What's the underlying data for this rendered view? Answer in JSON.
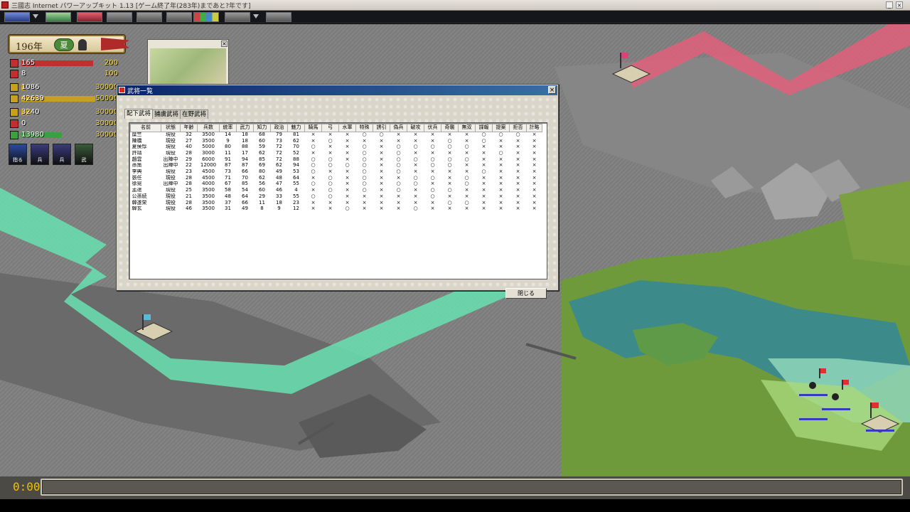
{
  "window": {
    "title": "三國志 Internet パワーアップキット 1.13 [ゲーム終了年(283年)まであと?年です]",
    "minimize": "_",
    "close": "×"
  },
  "status": {
    "year": "196年",
    "season": "夏",
    "stats": [
      {
        "icon": "soldier-icon",
        "value": "165",
        "max": "200",
        "color": "#c03030",
        "fill": 0.83
      },
      {
        "icon": "training-icon",
        "value": "8",
        "max": "100",
        "color": "#c03030",
        "fill": 0
      },
      {
        "icon": "gold-icon",
        "value": "1086",
        "max": "30000",
        "color": "#c8a020",
        "fill": 0.04
      },
      {
        "icon": "food-icon",
        "value": "42639",
        "max": "50000",
        "color": "#c8a020",
        "fill": 0.85
      },
      {
        "icon": "population-icon",
        "value": "3240",
        "max": "30000",
        "color": "#c8a020",
        "fill": 0.11
      },
      {
        "icon": "order-icon",
        "value": "0",
        "max": "30000",
        "color": "#c03030",
        "fill": 0
      },
      {
        "icon": "troops-icon",
        "value": "13980",
        "max": "30000",
        "color": "#3aa040",
        "fill": 0.47
      }
    ],
    "commands": [
      {
        "name": "hand-command-button",
        "label": "指る",
        "color": "#2a4aa0"
      },
      {
        "name": "officer-command-button-1",
        "label": "兵",
        "color": "#3a3a80"
      },
      {
        "name": "officer-command-button-2",
        "label": "兵",
        "color": "#3a3a80"
      },
      {
        "name": "officer-command-button-3",
        "label": "武",
        "color": "#3a5a3a"
      }
    ]
  },
  "minimap": {
    "close": "×"
  },
  "dialog": {
    "title": "武将一覧",
    "close_icon": "×",
    "tabs": [
      "配下武将",
      "捕虜武将",
      "在野武将"
    ],
    "columns": [
      "名前",
      "状態",
      "年齢",
      "兵数",
      "統率",
      "武力",
      "知力",
      "政治",
      "魅力",
      "騎馬",
      "弓",
      "水軍",
      "特殊",
      "誘引",
      "偽兵",
      "破攻",
      "伏兵",
      "奇襲",
      "無双",
      "諜報",
      "提案",
      "拒否",
      "計略"
    ],
    "rows": [
      [
        "糜竺",
        "現役",
        "32",
        "3500",
        "14",
        "18",
        "68",
        "79",
        "81",
        "×",
        "×",
        "×",
        "○",
        "○",
        "×",
        "×",
        "×",
        "×",
        "×",
        "○",
        "○",
        "○",
        "×"
      ],
      [
        "陳橋",
        "現役",
        "27",
        "3500",
        "9",
        "18",
        "60",
        "73",
        "62",
        "×",
        "○",
        "×",
        "×",
        "×",
        "×",
        "×",
        "×",
        "○",
        "×",
        "○",
        "×",
        "×",
        "×"
      ],
      [
        "夏侯惇",
        "現役",
        "40",
        "5000",
        "80",
        "88",
        "59",
        "72",
        "70",
        "○",
        "×",
        "×",
        "○",
        "×",
        "○",
        "○",
        "○",
        "○",
        "○",
        "×",
        "×",
        "×",
        "×"
      ],
      [
        "許靖",
        "現役",
        "28",
        "3000",
        "11",
        "17",
        "62",
        "72",
        "52",
        "×",
        "×",
        "×",
        "○",
        "×",
        "○",
        "×",
        "×",
        "×",
        "×",
        "×",
        "○",
        "×",
        "×"
      ],
      [
        "趙雲",
        "出陣中",
        "29",
        "6000",
        "91",
        "94",
        "85",
        "72",
        "88",
        "○",
        "○",
        "×",
        "○",
        "×",
        "○",
        "○",
        "○",
        "○",
        "○",
        "×",
        "×",
        "×",
        "×"
      ],
      [
        "孫策",
        "出陣中",
        "22",
        "12000",
        "87",
        "87",
        "69",
        "62",
        "94",
        "○",
        "○",
        "○",
        "○",
        "×",
        "○",
        "×",
        "○",
        "○",
        "×",
        "×",
        "×",
        "×",
        "×"
      ],
      [
        "李典",
        "現役",
        "23",
        "4500",
        "73",
        "66",
        "80",
        "49",
        "53",
        "○",
        "×",
        "×",
        "○",
        "×",
        "○",
        "×",
        "×",
        "×",
        "×",
        "○",
        "×",
        "×",
        "×"
      ],
      [
        "張任",
        "現役",
        "28",
        "4500",
        "71",
        "70",
        "62",
        "48",
        "64",
        "×",
        "○",
        "×",
        "○",
        "×",
        "×",
        "○",
        "○",
        "×",
        "○",
        "×",
        "×",
        "×",
        "×"
      ],
      [
        "徐晃",
        "出陣中",
        "28",
        "4000",
        "67",
        "85",
        "56",
        "47",
        "55",
        "○",
        "○",
        "×",
        "○",
        "×",
        "○",
        "○",
        "×",
        "×",
        "○",
        "×",
        "×",
        "×",
        "×"
      ],
      [
        "孟達",
        "現役",
        "25",
        "3500",
        "58",
        "54",
        "60",
        "46",
        "4",
        "×",
        "○",
        "×",
        "○",
        "×",
        "○",
        "×",
        "○",
        "○",
        "×",
        "×",
        "×",
        "×",
        "×"
      ],
      [
        "公孫続",
        "現役",
        "21",
        "3500",
        "48",
        "64",
        "29",
        "33",
        "55",
        "○",
        "○",
        "×",
        "×",
        "×",
        "×",
        "×",
        "○",
        "×",
        "×",
        "×",
        "×",
        "×",
        "×"
      ],
      [
        "韓遂栄",
        "現役",
        "28",
        "3500",
        "37",
        "66",
        "11",
        "18",
        "23",
        "×",
        "×",
        "×",
        "×",
        "×",
        "×",
        "×",
        "×",
        "○",
        "○",
        "×",
        "×",
        "×",
        "×"
      ],
      [
        "韓玄",
        "現役",
        "46",
        "3500",
        "31",
        "49",
        "8",
        "9",
        "12",
        "×",
        "×",
        "○",
        "×",
        "×",
        "×",
        "○",
        "×",
        "×",
        "×",
        "×",
        "×",
        "×",
        "×"
      ]
    ],
    "close_button": "閉じる"
  },
  "bottom": {
    "timer": "0:00"
  }
}
